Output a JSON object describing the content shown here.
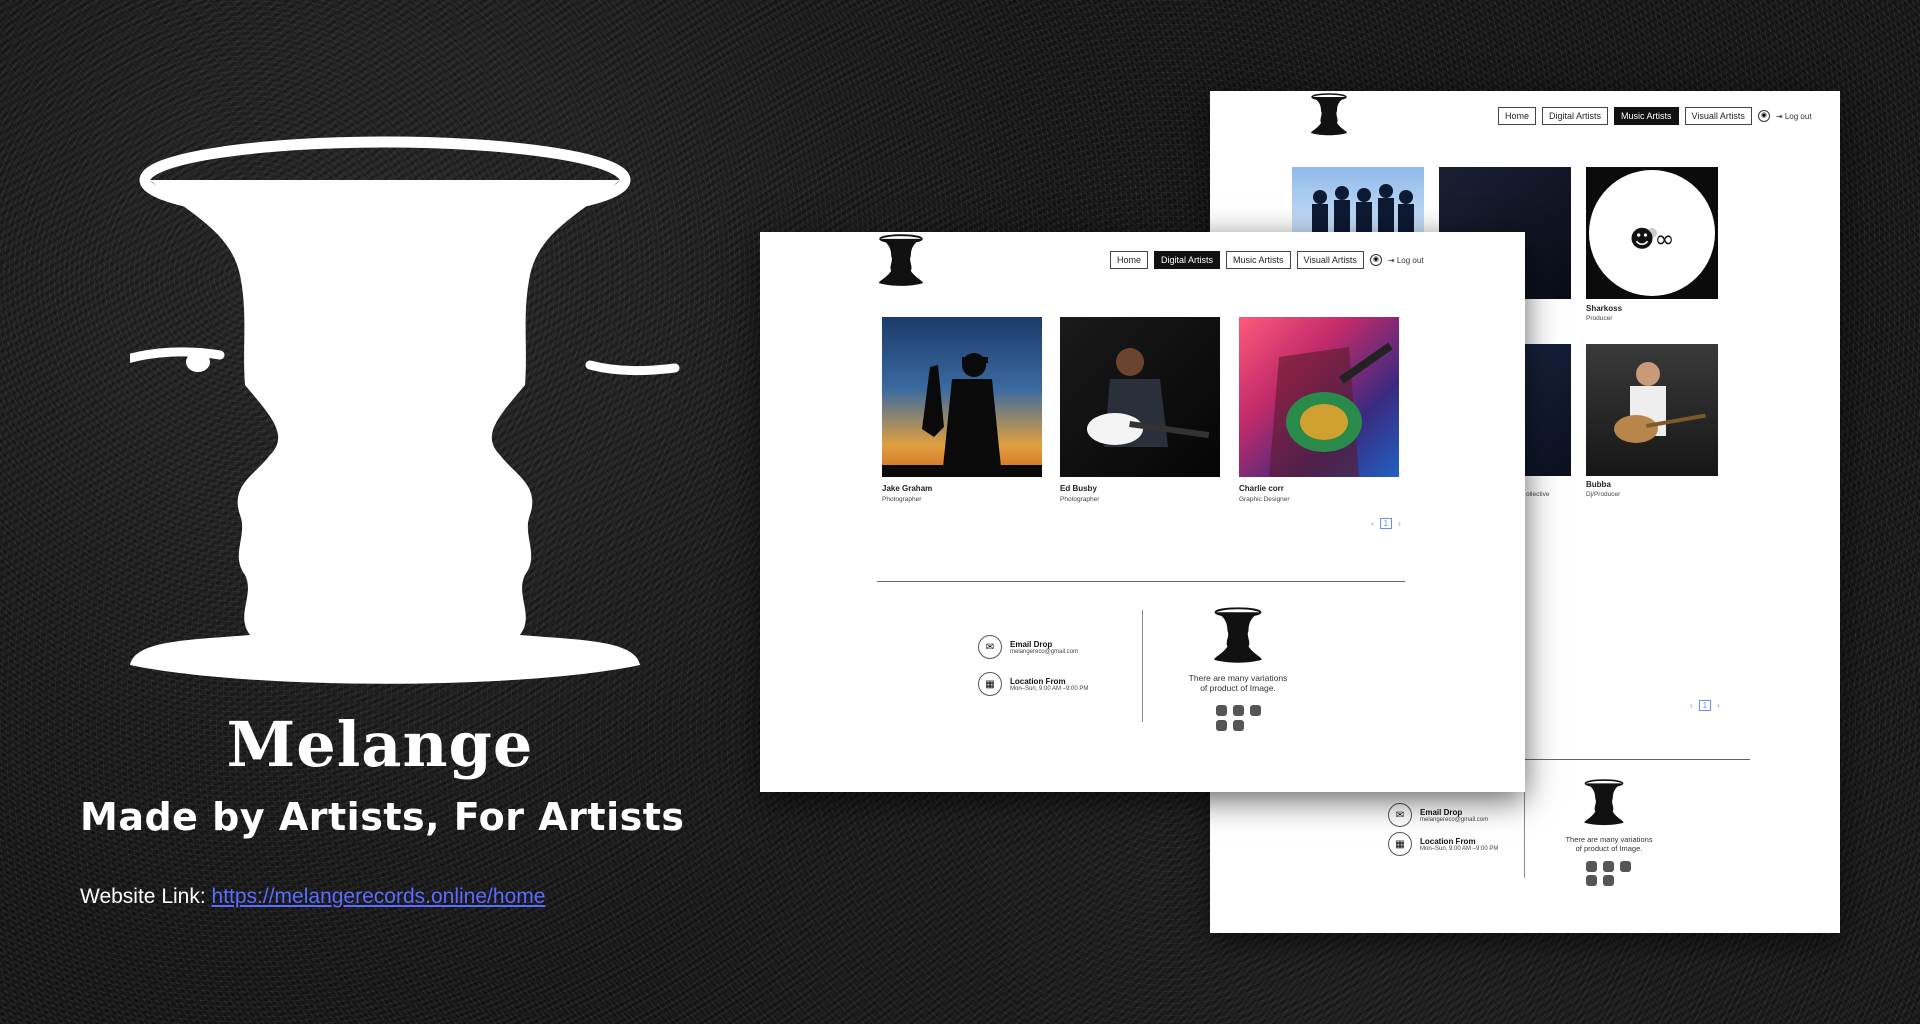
{
  "hero": {
    "brand": "Melange",
    "tagline": "Made by Artists, For Artists",
    "website_label": "Website Link: ",
    "website_url": "https://melangerecords.online/home"
  },
  "music_page": {
    "nav": [
      "Home",
      "Digital Artists",
      "Music Artists",
      "Visuall Artists"
    ],
    "active_nav": "Music Artists",
    "logout": "Log out",
    "artists": [
      {
        "name": "",
        "role": ""
      },
      {
        "name": "",
        "role": ""
      },
      {
        "name": "Sharkoss",
        "role": "Producer"
      },
      {
        "name": "",
        "role": "ollective"
      },
      {
        "name": "Bubba",
        "role": "Dj/Producer"
      }
    ],
    "page_number": "1",
    "footer": {
      "email_title": "Email Drop",
      "email_value": "melangereco@gmail.com",
      "location_title": "Location From",
      "location_value": "Mon–Sun, 9:00 AM –9:00 PM",
      "about_line1": "There are many variations",
      "about_line2": "of product of Image."
    }
  },
  "digital_page": {
    "nav": [
      "Home",
      "Digital Artists",
      "Music Artists",
      "Visuall Artists"
    ],
    "active_nav": "Digital Artists",
    "logout": "Log out",
    "artists": [
      {
        "name": "Jake Graham",
        "role": "Photographer"
      },
      {
        "name": "Ed Busby",
        "role": "Photographer"
      },
      {
        "name": "Charlie corr",
        "role": "Graphic Designer"
      }
    ],
    "page_number": "1",
    "footer": {
      "email_title": "Email Drop",
      "email_value": "melangereco@gmail.com",
      "location_title": "Location From",
      "location_value": "Mon–Sun, 9:00 AM –9:00 PM",
      "about_line1": "There are many variations",
      "about_line2": "of product of Image."
    }
  },
  "colors": {
    "link": "#5a6bff",
    "active_nav_bg": "#111111",
    "pager": "#6a8cff"
  }
}
